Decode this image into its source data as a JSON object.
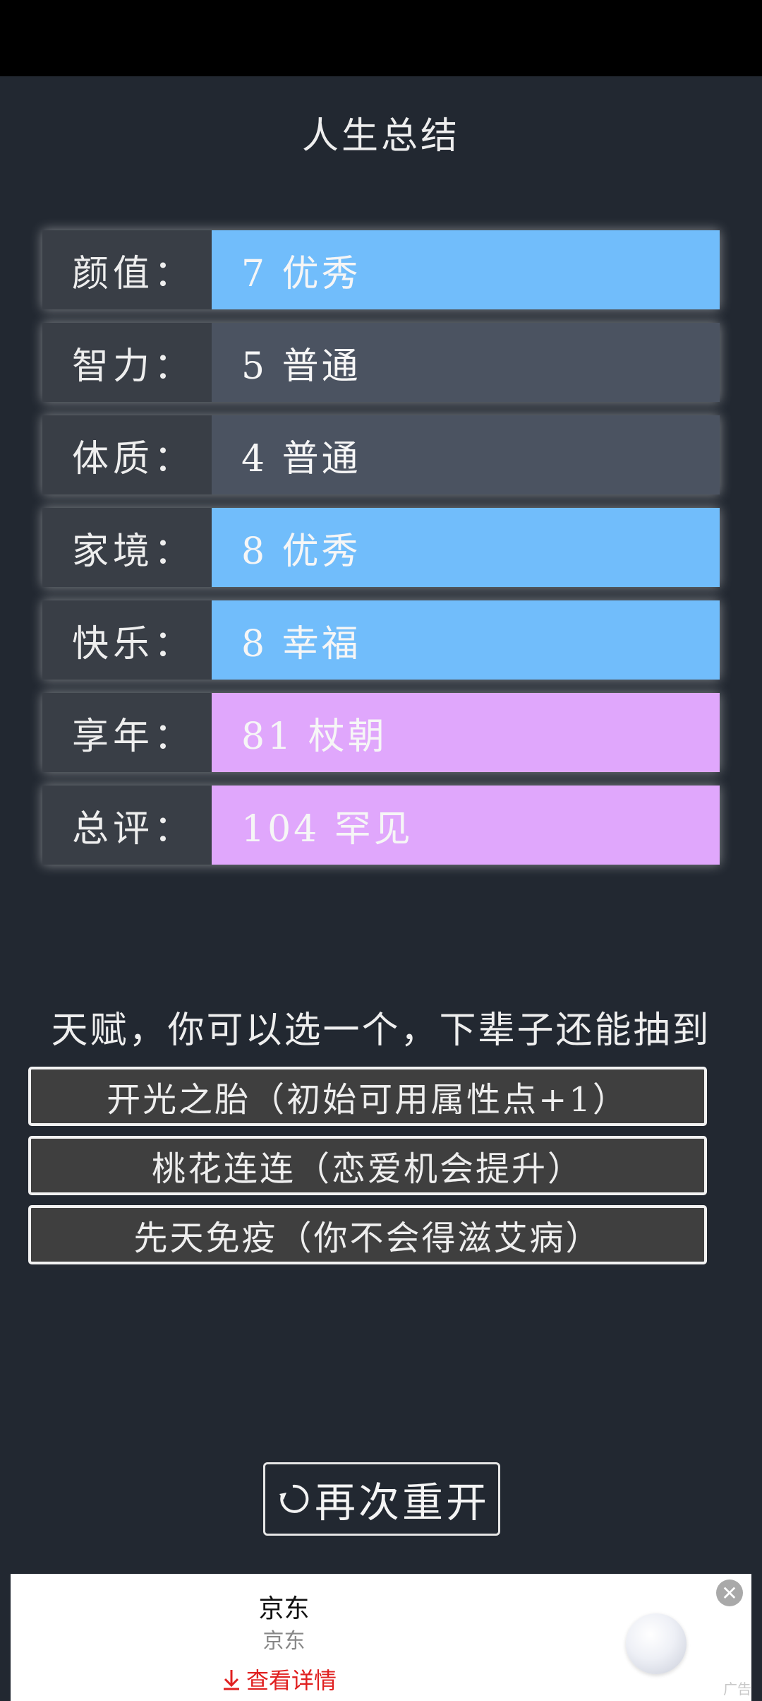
{
  "header": {
    "title": "人生总结"
  },
  "summary": [
    {
      "label": "颜值：",
      "value": "7 优秀",
      "tier": "excellent"
    },
    {
      "label": "智力：",
      "value": "5 普通",
      "tier": "common"
    },
    {
      "label": "体质：",
      "value": "4 普通",
      "tier": "common"
    },
    {
      "label": "家境：",
      "value": "8 优秀",
      "tier": "excellent"
    },
    {
      "label": "快乐：",
      "value": "8 幸福",
      "tier": "excellent"
    },
    {
      "label": "享年：",
      "value": "81 杖朝",
      "tier": "rare"
    },
    {
      "label": "总评：",
      "value": "104 罕见",
      "tier": "rare"
    }
  ],
  "talents": {
    "title": "天赋，你可以选一个，下辈子还能抽到",
    "items": [
      "开光之胎（初始可用属性点+1）",
      "桃花连连（恋爱机会提升）",
      "先天免疫（你不会得滋艾病）"
    ]
  },
  "actions": {
    "restart_label": "再次重开",
    "restart_icon": "refresh-icon"
  },
  "ad": {
    "brand": "京东",
    "subtitle": "京东",
    "cta": "查看详情",
    "tag": "广告"
  },
  "colors": {
    "background": "#222831",
    "tier_common": "#4b5361",
    "tier_excellent": "#71bdfb",
    "tier_rare": "#e0a7fc",
    "ad_cta": "#e02020"
  }
}
